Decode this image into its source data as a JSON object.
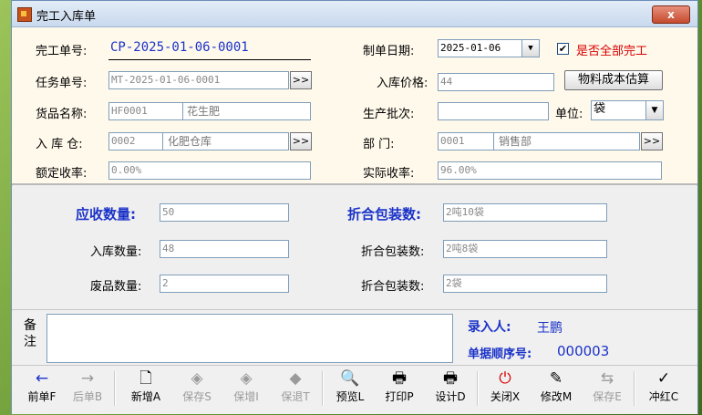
{
  "window": {
    "title": "完工入库单",
    "close_label": "x"
  },
  "form": {
    "finish_no_label": "完工单号:",
    "finish_no_value": "CP-2025-01-06-0001",
    "make_date_label": "制单日期:",
    "make_date_value": "2025-01-06",
    "all_done_label": "是否全部完工",
    "all_done_checked": "✔",
    "task_no_label": "任务单号:",
    "task_no_value": "MT-2025-01-06-0001",
    "lookup_btn": ">>",
    "in_price_label": "入库价格:",
    "in_price_value": "44",
    "cost_estimate_btn": "物料成本估算",
    "goods_name_label": "货品名称:",
    "goods_code": "HF0001",
    "goods_name": "花生肥",
    "batch_label": "生产批次:",
    "batch_value": "",
    "unit_label": "单位:",
    "unit_value": "袋",
    "warehouse_label": "入 库 仓:",
    "warehouse_code": "0002",
    "warehouse_name": "化肥仓库",
    "dept_label": "部      门:",
    "dept_code": "0001",
    "dept_name": "销售部",
    "rated_rate_label": "额定收率:",
    "rated_rate_value": "0.00%",
    "actual_rate_label": "实际收率:",
    "actual_rate_value": "96.00%"
  },
  "quantities": {
    "receivable_label": "应收数量:",
    "receivable_value": "50",
    "pack_total_label": "折合包装数:",
    "pack_total_value": "2吨10袋",
    "in_qty_label": "入库数量:",
    "in_qty_value": "48",
    "pack_in_label": "折合包装数:",
    "pack_in_value": "2吨8袋",
    "waste_label": "废品数量:",
    "waste_value": "2",
    "pack_waste_label": "折合包装数:",
    "pack_waste_value": "2袋"
  },
  "remarks": {
    "label_1": "备",
    "label_2": "注",
    "entered_by_label": "录入人:",
    "entered_by_value": "王鹏",
    "seq_label": "单据顺序号:",
    "seq_value": "000003"
  },
  "toolbar": [
    {
      "label": "前单F",
      "icon": "←",
      "enabled": true
    },
    {
      "label": "后单B",
      "icon": "→",
      "enabled": false
    },
    {
      "label": "新增A",
      "icon": "🗋",
      "enabled": true
    },
    {
      "label": "保存S",
      "icon": "◈",
      "enabled": false
    },
    {
      "label": "保增I",
      "icon": "◈",
      "enabled": false
    },
    {
      "label": "保退T",
      "icon": "◆",
      "enabled": false
    },
    {
      "label": "预览L",
      "icon": "🔍",
      "enabled": true
    },
    {
      "label": "打印P",
      "icon": "🖶",
      "enabled": true
    },
    {
      "label": "设计D",
      "icon": "🖶",
      "enabled": true
    },
    {
      "label": "关闭X",
      "icon": "⏻",
      "enabled": true
    },
    {
      "label": "修改M",
      "icon": "✎",
      "enabled": true
    },
    {
      "label": "保存E",
      "icon": "⇆",
      "enabled": false
    },
    {
      "label": "冲红C",
      "icon": "✓",
      "enabled": true
    }
  ],
  "colors": {
    "accent_blue": "#1a32c8",
    "warning_red": "#d80000",
    "header_bg": "#fff9ec"
  }
}
